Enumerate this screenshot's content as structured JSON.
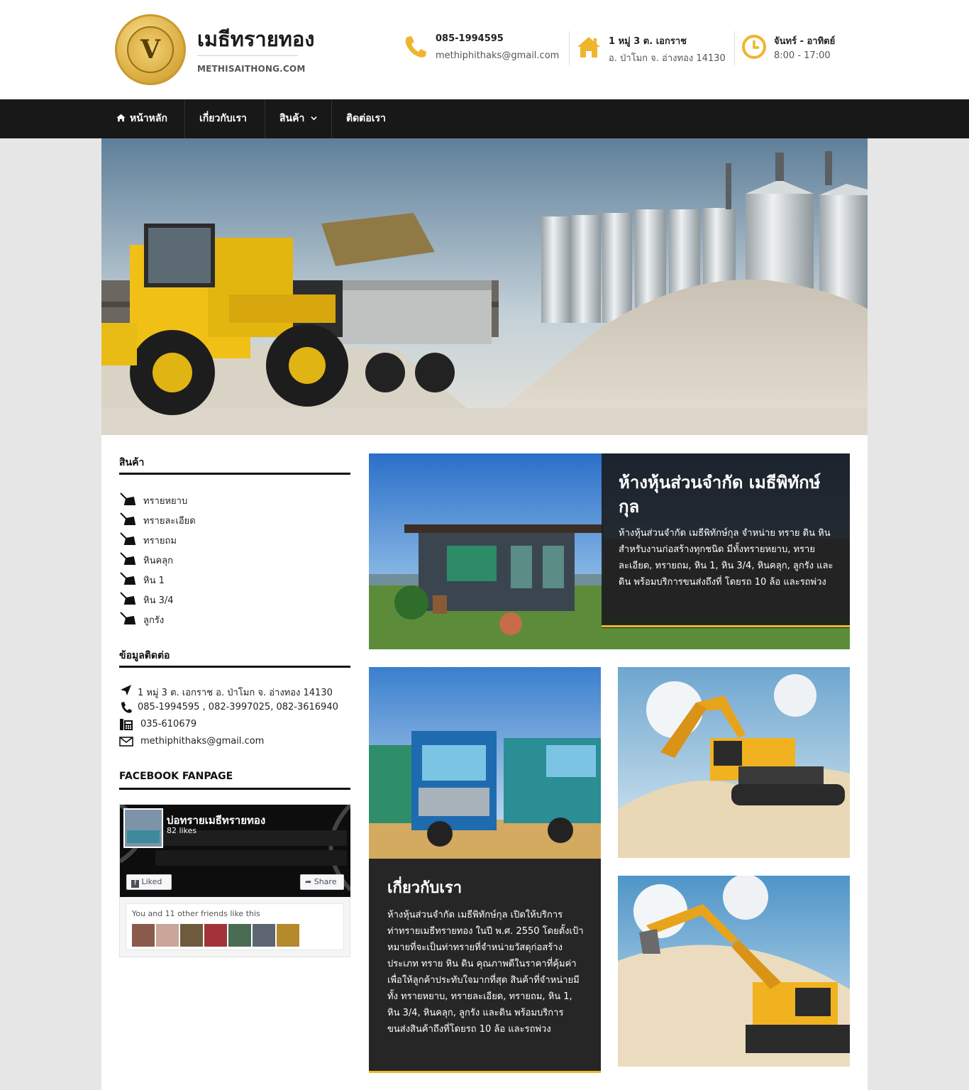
{
  "header": {
    "logo_text": "V",
    "site_title": "เมธีทรายทอง",
    "site_sub": "METHISAITHONG.COM",
    "phone": "085-1994595",
    "email": "methiphithaks@gmail.com",
    "address_line1": "1 หมู่ 3 ต. เอกราช",
    "address_line2": "อ. ป่าโมก จ. อ่างทอง 14130",
    "hours_days": "จันทร์ - อาทิตย์",
    "hours_time": "8:00 - 17:00"
  },
  "nav": {
    "home": "หน้าหลัก",
    "about": "เกี่ยวกับเรา",
    "products": "สินค้า",
    "contact": "ติดต่อเรา"
  },
  "sidebar": {
    "products_title": "สินค้า",
    "products": [
      "ทรายหยาบ",
      "ทรายละเอียด",
      "ทรายถม",
      "หินคลุก",
      "หิน 1",
      "หิน 3/4",
      "ลูกรัง"
    ],
    "contact_title": "ข้อมูลติดต่อ",
    "contact": {
      "address": "1 หมู่ 3 ต. เอกราช อ. ป่าโมก จ. อ่างทอง 14130",
      "phones": "085-1994595 , 082-3997025, 082-3616940",
      "fax": "035-610679",
      "email": "methiphithaks@gmail.com"
    },
    "fb_title": "FACEBOOK FANPAGE",
    "fb": {
      "page_name": "บ่อทรายเมธีทรายทอง",
      "likes": "82 likes",
      "liked_btn": "Liked",
      "share_btn": "Share",
      "friends_text": "You and 11 other friends like this"
    }
  },
  "cards": {
    "company_title": "ห้างหุ้นส่วนจำกัด เมธีพิทักษ์กุล",
    "company_text": "ห้างหุ้นส่วนจำกัด เมธีพิทักษ์กุล จำหน่าย ทราย ดิน  หิน สำหรับงานก่อสร้างทุกชนิด มีทั้งทรายหยาบ, ทรายละเอียด, ทรายถม, หิน 1, หิน 3/4, หินคลุก, ลูกรัง และดิน พร้อมบริการขนส่งถึงที่ โดยรถ 10 ล้อ และรถพ่วง",
    "about_title": "เกี่ยวกับเรา",
    "about_text": "ห้างหุ้นส่วนจำกัด เมธีพิทักษ์กุล เปิดให้บริการท่าทรายเมธีทรายทอง ในปี พ.ศ. 2550 โดยตั้งเป้าหมายที่จะเป็นท่าทรายที่จำหน่ายวัสดุก่อสร้างประเภท ทราย หิน ดิน คุณภาพดีในราคาที่คุ้มค่า เพื่อให้ลูกค้าประทับใจมากที่สุด สินค้าที่จำหน่ายมีทั้ง ทรายหยาบ, ทรายละเอียด, ทรายถม, หิน 1, หิน 3/4, หินคลุก, ลูกรัง และดิน พร้อมบริการขนส่งสินค้าถึงที่โดยรถ 10 ล้อ และรถพ่วง"
  },
  "colors": {
    "accent": "#e9b92d",
    "nav_bg": "#181818"
  }
}
